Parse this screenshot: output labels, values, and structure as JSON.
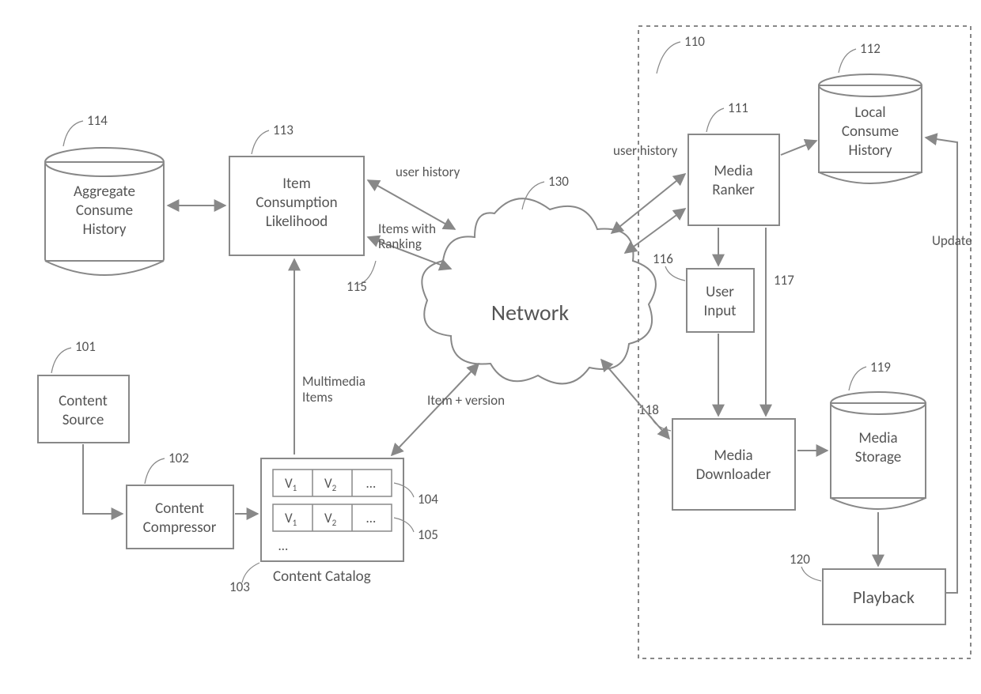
{
  "refs": {
    "r101": "101",
    "r102": "102",
    "r103": "103",
    "r104": "104",
    "r105": "105",
    "r110": "110",
    "r111": "111",
    "r112": "112",
    "r113": "113",
    "r114": "114",
    "r115": "115",
    "r116": "116",
    "r117": "117",
    "r118": "118",
    "r119": "119",
    "r120": "120",
    "r130": "130"
  },
  "blocks": {
    "aggregate_l1": "Aggregate",
    "aggregate_l2": "Consume",
    "aggregate_l3": "History",
    "item_l1": "Item",
    "item_l2": "Consumption",
    "item_l3": "Likelihood",
    "content_source_l1": "Content",
    "content_source_l2": "Source",
    "content_compressor_l1": "Content",
    "content_compressor_l2": "Compressor",
    "content_catalog": "Content Catalog",
    "network": "Network",
    "media_ranker_l1": "Media",
    "media_ranker_l2": "Ranker",
    "local_history_l1": "Local",
    "local_history_l2": "Consume",
    "local_history_l3": "History",
    "user_input_l1": "User",
    "user_input_l2": "Input",
    "media_downloader_l1": "Media",
    "media_downloader_l2": "Downloader",
    "media_storage_l1": "Media",
    "media_storage_l2": "Storage",
    "playback": "Playback"
  },
  "edge_labels": {
    "user_history": "user history",
    "items_ranking_l1": "Items with",
    "items_ranking_l2": "Ranking",
    "multimedia_l1": "Multimedia",
    "multimedia_l2": "Items",
    "item_version": "Item + version",
    "update": "Update"
  },
  "catalog": {
    "v1": "V",
    "v1_sub": "1",
    "v2": "V",
    "v2_sub": "2",
    "dots": "…"
  }
}
